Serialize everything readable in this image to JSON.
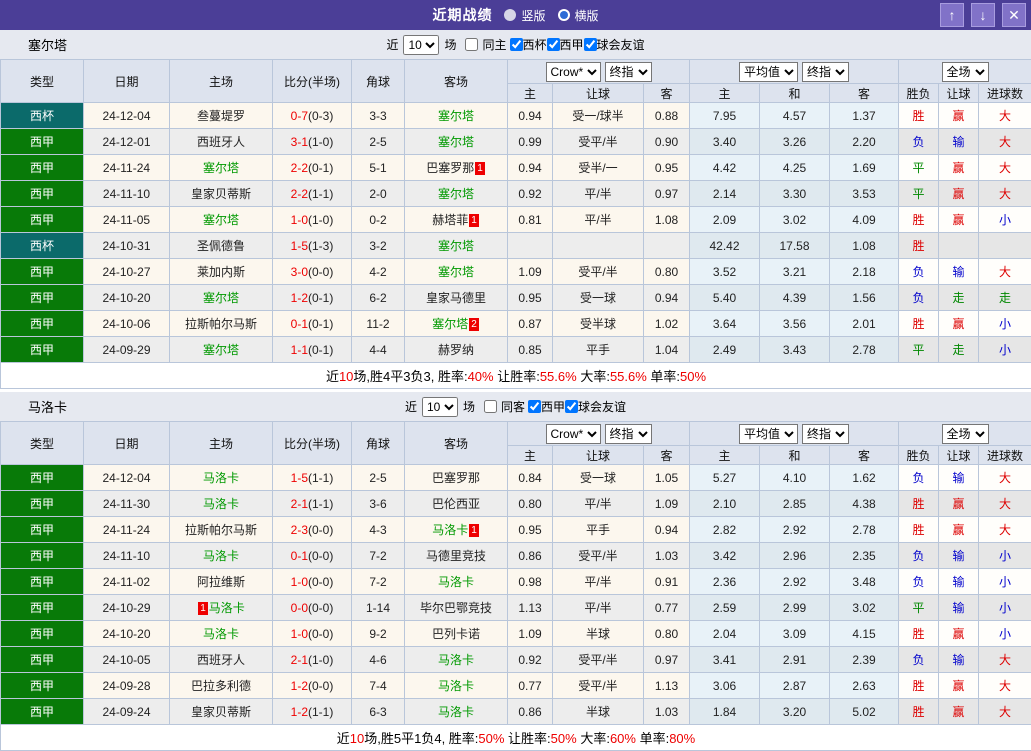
{
  "titlebar": {
    "title": "近期战绩",
    "portrait_label": "竖版",
    "landscape_label": "横版"
  },
  "window_buttons": {
    "up": "↑",
    "down": "↓",
    "close": "✕"
  },
  "colors": {
    "titlebar_bg": "#4b3e97",
    "liga_badge": "#087a08",
    "cup_badge": "#0b6a6a",
    "self_team_green": "#009900",
    "win_red": "#dd0000",
    "lose_blue": "#0000cc",
    "draw_green": "#008800"
  },
  "table_headers": {
    "type": "类型",
    "date": "日期",
    "home": "主场",
    "score": "比分(半场)",
    "corners": "角球",
    "away": "客场",
    "odds_home": "主",
    "odds_handicap": "让球",
    "odds_away": "客",
    "avg_home": "主",
    "avg_draw": "和",
    "avg_away": "客",
    "result_wdl": "胜负",
    "result_handicap": "让球",
    "result_goals": "进球数"
  },
  "sections": [
    {
      "team": "塞尔塔",
      "filter": {
        "prefix": "近",
        "count": "10",
        "suffix": "场",
        "same_label": "同主",
        "same_checked": false,
        "league_filters": [
          {
            "label": "西杯",
            "checked": true
          },
          {
            "label": "西甲",
            "checked": true
          },
          {
            "label": "球会友谊",
            "checked": true
          }
        ]
      },
      "selects": {
        "company": "Crow*",
        "company_period": "终指",
        "average": "平均值",
        "average_period": "终指",
        "scope": "全场"
      },
      "rows": [
        {
          "type": "西杯",
          "date": "24-12-04",
          "home": "叁蔓堤罗",
          "score": "0-7",
          "half": "(0-3)",
          "corners": "3-3",
          "away": "塞尔塔",
          "odds_home": "0.94",
          "handicap": "受一/球半",
          "odds_away": "0.88",
          "avg_home": "7.95",
          "avg_draw": "4.57",
          "avg_away": "1.37",
          "res_wdl": "胜",
          "res_handicap": "赢",
          "res_goals": "大"
        },
        {
          "type": "西甲",
          "date": "24-12-01",
          "home": "西班牙人",
          "score": "3-1",
          "half": "(1-0)",
          "corners": "2-5",
          "away": "塞尔塔",
          "odds_home": "0.99",
          "handicap": "受平/半",
          "odds_away": "0.90",
          "avg_home": "3.40",
          "avg_draw": "3.26",
          "avg_away": "2.20",
          "res_wdl": "负",
          "res_handicap": "输",
          "res_goals": "大"
        },
        {
          "type": "西甲",
          "date": "24-11-24",
          "home": "塞尔塔",
          "score": "2-2",
          "half": "(0-1)",
          "corners": "5-1",
          "away": "巴塞罗那",
          "away_badge": "1",
          "odds_home": "0.94",
          "handicap": "受半/一",
          "odds_away": "0.95",
          "avg_home": "4.42",
          "avg_draw": "4.25",
          "avg_away": "1.69",
          "res_wdl": "平",
          "res_handicap": "赢",
          "res_goals": "大"
        },
        {
          "type": "西甲",
          "date": "24-11-10",
          "home": "皇家贝蒂斯",
          "score": "2-2",
          "half": "(1-1)",
          "corners": "2-0",
          "away": "塞尔塔",
          "odds_home": "0.92",
          "handicap": "平/半",
          "odds_away": "0.97",
          "avg_home": "2.14",
          "avg_draw": "3.30",
          "avg_away": "3.53",
          "res_wdl": "平",
          "res_handicap": "赢",
          "res_goals": "大"
        },
        {
          "type": "西甲",
          "date": "24-11-05",
          "home": "塞尔塔",
          "score": "1-0",
          "half": "(1-0)",
          "corners": "0-2",
          "away": "赫塔菲",
          "away_badge": "1",
          "odds_home": "0.81",
          "handicap": "平/半",
          "odds_away": "1.08",
          "avg_home": "2.09",
          "avg_draw": "3.02",
          "avg_away": "4.09",
          "res_wdl": "胜",
          "res_handicap": "赢",
          "res_goals": "小"
        },
        {
          "type": "西杯",
          "date": "24-10-31",
          "home": "圣佩德鲁",
          "score": "1-5",
          "half": "(1-3)",
          "corners": "3-2",
          "away": "塞尔塔",
          "odds_home": "",
          "handicap": "",
          "odds_away": "",
          "avg_home": "42.42",
          "avg_draw": "17.58",
          "avg_away": "1.08",
          "res_wdl": "胜",
          "res_handicap": "",
          "res_goals": ""
        },
        {
          "type": "西甲",
          "date": "24-10-27",
          "home": "莱加内斯",
          "score": "3-0",
          "half": "(0-0)",
          "corners": "4-2",
          "away": "塞尔塔",
          "odds_home": "1.09",
          "handicap": "受平/半",
          "odds_away": "0.80",
          "avg_home": "3.52",
          "avg_draw": "3.21",
          "avg_away": "2.18",
          "res_wdl": "负",
          "res_handicap": "输",
          "res_goals": "大"
        },
        {
          "type": "西甲",
          "date": "24-10-20",
          "home": "塞尔塔",
          "score": "1-2",
          "half": "(0-1)",
          "corners": "6-2",
          "away": "皇家马德里",
          "odds_home": "0.95",
          "handicap": "受一球",
          "odds_away": "0.94",
          "avg_home": "5.40",
          "avg_draw": "4.39",
          "avg_away": "1.56",
          "res_wdl": "负",
          "res_handicap": "走",
          "res_goals": "走"
        },
        {
          "type": "西甲",
          "date": "24-10-06",
          "home": "拉斯帕尔马斯",
          "score": "0-1",
          "half": "(0-1)",
          "corners": "11-2",
          "away": "塞尔塔",
          "away_badge": "2",
          "odds_home": "0.87",
          "handicap": "受半球",
          "odds_away": "1.02",
          "avg_home": "3.64",
          "avg_draw": "3.56",
          "avg_away": "2.01",
          "res_wdl": "胜",
          "res_handicap": "赢",
          "res_goals": "小"
        },
        {
          "type": "西甲",
          "date": "24-09-29",
          "home": "塞尔塔",
          "score": "1-1",
          "half": "(0-1)",
          "corners": "4-4",
          "away": "赫罗纳",
          "odds_home": "0.85",
          "handicap": "平手",
          "odds_away": "1.04",
          "avg_home": "2.49",
          "avg_draw": "3.43",
          "avg_away": "2.78",
          "res_wdl": "平",
          "res_handicap": "走",
          "res_goals": "小"
        }
      ],
      "summary": [
        {
          "t": "近"
        },
        {
          "t": "10",
          "red": true
        },
        {
          "t": "场,胜4平3负3, 胜率:"
        },
        {
          "t": "40%",
          "red": true
        },
        {
          "t": " 让胜率:"
        },
        {
          "t": "55.6%",
          "red": true
        },
        {
          "t": " 大率:"
        },
        {
          "t": "55.6%",
          "red": true
        },
        {
          "t": " 单率:"
        },
        {
          "t": "50%",
          "red": true
        }
      ]
    },
    {
      "team": "马洛卡",
      "filter": {
        "prefix": "近",
        "count": "10",
        "suffix": "场",
        "same_label": "同客",
        "same_checked": false,
        "league_filters": [
          {
            "label": "西甲",
            "checked": true
          },
          {
            "label": "球会友谊",
            "checked": true
          }
        ]
      },
      "selects": {
        "company": "Crow*",
        "company_period": "终指",
        "average": "平均值",
        "average_period": "终指",
        "scope": "全场"
      },
      "rows": [
        {
          "type": "西甲",
          "date": "24-12-04",
          "home": "马洛卡",
          "score": "1-5",
          "half": "(1-1)",
          "corners": "2-5",
          "away": "巴塞罗那",
          "odds_home": "0.84",
          "handicap": "受一球",
          "odds_away": "1.05",
          "avg_home": "5.27",
          "avg_draw": "4.10",
          "avg_away": "1.62",
          "res_wdl": "负",
          "res_handicap": "输",
          "res_goals": "大"
        },
        {
          "type": "西甲",
          "date": "24-11-30",
          "home": "马洛卡",
          "score": "2-1",
          "half": "(1-1)",
          "corners": "3-6",
          "away": "巴伦西亚",
          "odds_home": "0.80",
          "handicap": "平/半",
          "odds_away": "1.09",
          "avg_home": "2.10",
          "avg_draw": "2.85",
          "avg_away": "4.38",
          "res_wdl": "胜",
          "res_handicap": "赢",
          "res_goals": "大"
        },
        {
          "type": "西甲",
          "date": "24-11-24",
          "home": "拉斯帕尔马斯",
          "score": "2-3",
          "half": "(0-0)",
          "corners": "4-3",
          "away": "马洛卡",
          "away_badge": "1",
          "odds_home": "0.95",
          "handicap": "平手",
          "odds_away": "0.94",
          "avg_home": "2.82",
          "avg_draw": "2.92",
          "avg_away": "2.78",
          "res_wdl": "胜",
          "res_handicap": "赢",
          "res_goals": "大"
        },
        {
          "type": "西甲",
          "date": "24-11-10",
          "home": "马洛卡",
          "score": "0-1",
          "half": "(0-0)",
          "corners": "7-2",
          "away": "马德里竞技",
          "odds_home": "0.86",
          "handicap": "受平/半",
          "odds_away": "1.03",
          "avg_home": "3.42",
          "avg_draw": "2.96",
          "avg_away": "2.35",
          "res_wdl": "负",
          "res_handicap": "输",
          "res_goals": "小"
        },
        {
          "type": "西甲",
          "date": "24-11-02",
          "home": "阿拉维斯",
          "score": "1-0",
          "half": "(0-0)",
          "corners": "7-2",
          "away": "马洛卡",
          "odds_home": "0.98",
          "handicap": "平/半",
          "odds_away": "0.91",
          "avg_home": "2.36",
          "avg_draw": "2.92",
          "avg_away": "3.48",
          "res_wdl": "负",
          "res_handicap": "输",
          "res_goals": "小"
        },
        {
          "type": "西甲",
          "date": "24-10-29",
          "home": "马洛卡",
          "home_badge": "1",
          "home_badge_pos": "before",
          "score": "0-0",
          "half": "(0-0)",
          "corners": "1-14",
          "away": "毕尔巴鄂竞技",
          "odds_home": "1.13",
          "handicap": "平/半",
          "odds_away": "0.77",
          "avg_home": "2.59",
          "avg_draw": "2.99",
          "avg_away": "3.02",
          "res_wdl": "平",
          "res_handicap": "输",
          "res_goals": "小"
        },
        {
          "type": "西甲",
          "date": "24-10-20",
          "home": "马洛卡",
          "score": "1-0",
          "half": "(0-0)",
          "corners": "9-2",
          "away": "巴列卡诺",
          "odds_home": "1.09",
          "handicap": "半球",
          "odds_away": "0.80",
          "avg_home": "2.04",
          "avg_draw": "3.09",
          "avg_away": "4.15",
          "res_wdl": "胜",
          "res_handicap": "赢",
          "res_goals": "小"
        },
        {
          "type": "西甲",
          "date": "24-10-05",
          "home": "西班牙人",
          "score": "2-1",
          "half": "(1-0)",
          "corners": "4-6",
          "away": "马洛卡",
          "odds_home": "0.92",
          "handicap": "受平/半",
          "odds_away": "0.97",
          "avg_home": "3.41",
          "avg_draw": "2.91",
          "avg_away": "2.39",
          "res_wdl": "负",
          "res_handicap": "输",
          "res_goals": "大"
        },
        {
          "type": "西甲",
          "date": "24-09-28",
          "home": "巴拉多利德",
          "score": "1-2",
          "half": "(0-0)",
          "corners": "7-4",
          "away": "马洛卡",
          "odds_home": "0.77",
          "handicap": "受平/半",
          "odds_away": "1.13",
          "avg_home": "3.06",
          "avg_draw": "2.87",
          "avg_away": "2.63",
          "res_wdl": "胜",
          "res_handicap": "赢",
          "res_goals": "大"
        },
        {
          "type": "西甲",
          "date": "24-09-24",
          "home": "皇家贝蒂斯",
          "score": "1-2",
          "half": "(1-1)",
          "corners": "6-3",
          "away": "马洛卡",
          "odds_home": "0.86",
          "handicap": "半球",
          "odds_away": "1.03",
          "avg_home": "1.84",
          "avg_draw": "3.20",
          "avg_away": "5.02",
          "res_wdl": "胜",
          "res_handicap": "赢",
          "res_goals": "大"
        }
      ],
      "summary": [
        {
          "t": "近"
        },
        {
          "t": "10",
          "red": true
        },
        {
          "t": "场,胜5平1负4, 胜率:"
        },
        {
          "t": "50%",
          "red": true
        },
        {
          "t": " 让胜率:"
        },
        {
          "t": "50%",
          "red": true
        },
        {
          "t": " 大率:"
        },
        {
          "t": "60%",
          "red": true
        },
        {
          "t": " 单率:"
        },
        {
          "t": "80%",
          "red": true
        }
      ]
    }
  ]
}
